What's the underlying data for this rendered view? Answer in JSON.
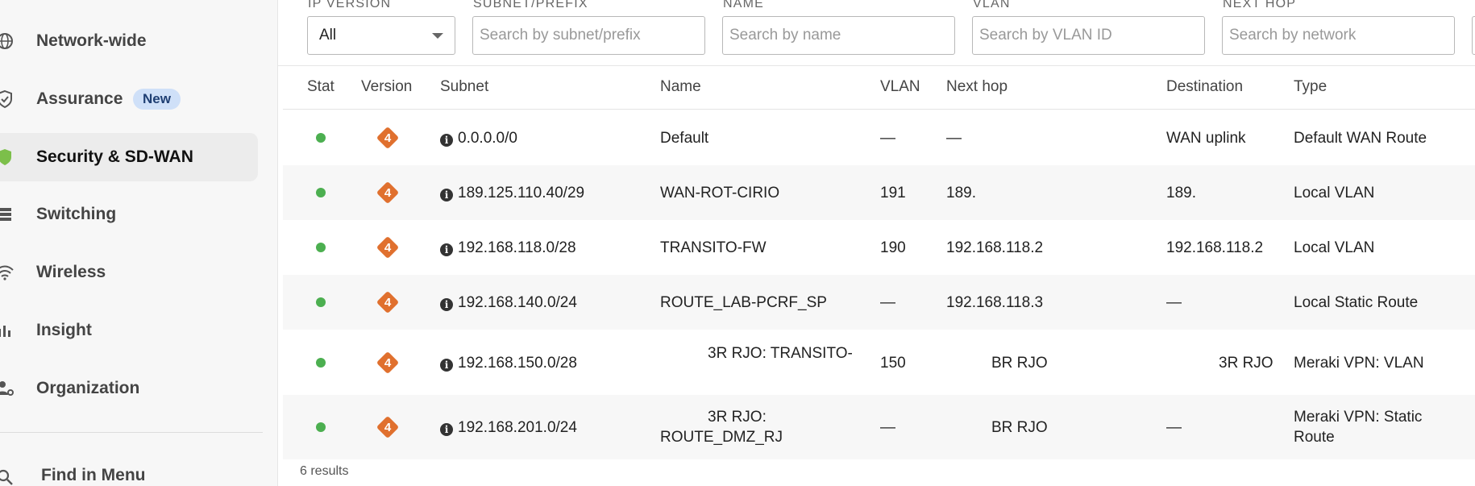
{
  "sidebar": {
    "items": [
      {
        "label": "Network-wide",
        "icon": "globe-icon"
      },
      {
        "label": "Assurance",
        "icon": "shield-check-icon",
        "badge": "New"
      },
      {
        "label": "Security & SD-WAN",
        "icon": "shield-icon"
      },
      {
        "label": "Switching",
        "icon": "switch-icon"
      },
      {
        "label": "Wireless",
        "icon": "wifi-icon"
      },
      {
        "label": "Insight",
        "icon": "bar-chart-icon"
      },
      {
        "label": "Organization",
        "icon": "organization-icon"
      }
    ],
    "find_in_menu": "Find in Menu"
  },
  "filters": {
    "ip_version": {
      "label": "IP VERSION",
      "value": "All"
    },
    "subnet": {
      "label": "SUBNET/PREFIX",
      "placeholder": "Search by subnet/prefix"
    },
    "name": {
      "label": "NAME",
      "placeholder": "Search by name"
    },
    "vlan": {
      "label": "VLAN",
      "placeholder": "Search by VLAN ID"
    },
    "next_hop": {
      "label": "NEXT HOP",
      "placeholder": "Search by network"
    }
  },
  "table": {
    "columns": [
      "Stat",
      "Version",
      "Subnet",
      "Name",
      "VLAN",
      "Next hop",
      "Destination",
      "Type"
    ],
    "version_label": "4",
    "info_glyph": "i",
    "rows": [
      {
        "subnet": "0.0.0.0/0",
        "name": "Default",
        "vlan": "—",
        "next_hop": "—",
        "destination": "WAN uplink",
        "type": "Default WAN Route"
      },
      {
        "subnet": "189.125.110.40/29",
        "name": "WAN-ROT-CIRIO",
        "vlan": "191",
        "next_hop": "189.",
        "destination": "189.",
        "type": "Local VLAN"
      },
      {
        "subnet": "192.168.118.0/28",
        "name": "TRANSITO-FW",
        "vlan": "190",
        "next_hop": "192.168.118.2",
        "destination": "192.168.118.2",
        "type": "Local VLAN"
      },
      {
        "subnet": "192.168.140.0/24",
        "name": "ROUTE_LAB-PCRF_SP",
        "vlan": "—",
        "next_hop": "192.168.118.3",
        "destination": "—",
        "type": "Local Static Route"
      },
      {
        "subnet": "192.168.150.0/28",
        "name": "3R RJO: TRANSITO-",
        "vlan": "150",
        "next_hop": "BR RJO",
        "destination": "3R RJO",
        "type": "Meraki VPN: VLAN"
      },
      {
        "subnet": "192.168.201.0/24",
        "name": "3R RJO: ROUTE_DMZ_RJ",
        "vlan": "—",
        "next_hop": "BR RJO",
        "destination": "—",
        "type": "Meraki VPN: Static Route"
      }
    ],
    "results_text": "6 results"
  },
  "colors": {
    "status_green": "#4caf50",
    "version_orange": "#e0702e",
    "badge_bg": "#cfe0f8",
    "active_bg": "#ececec"
  }
}
